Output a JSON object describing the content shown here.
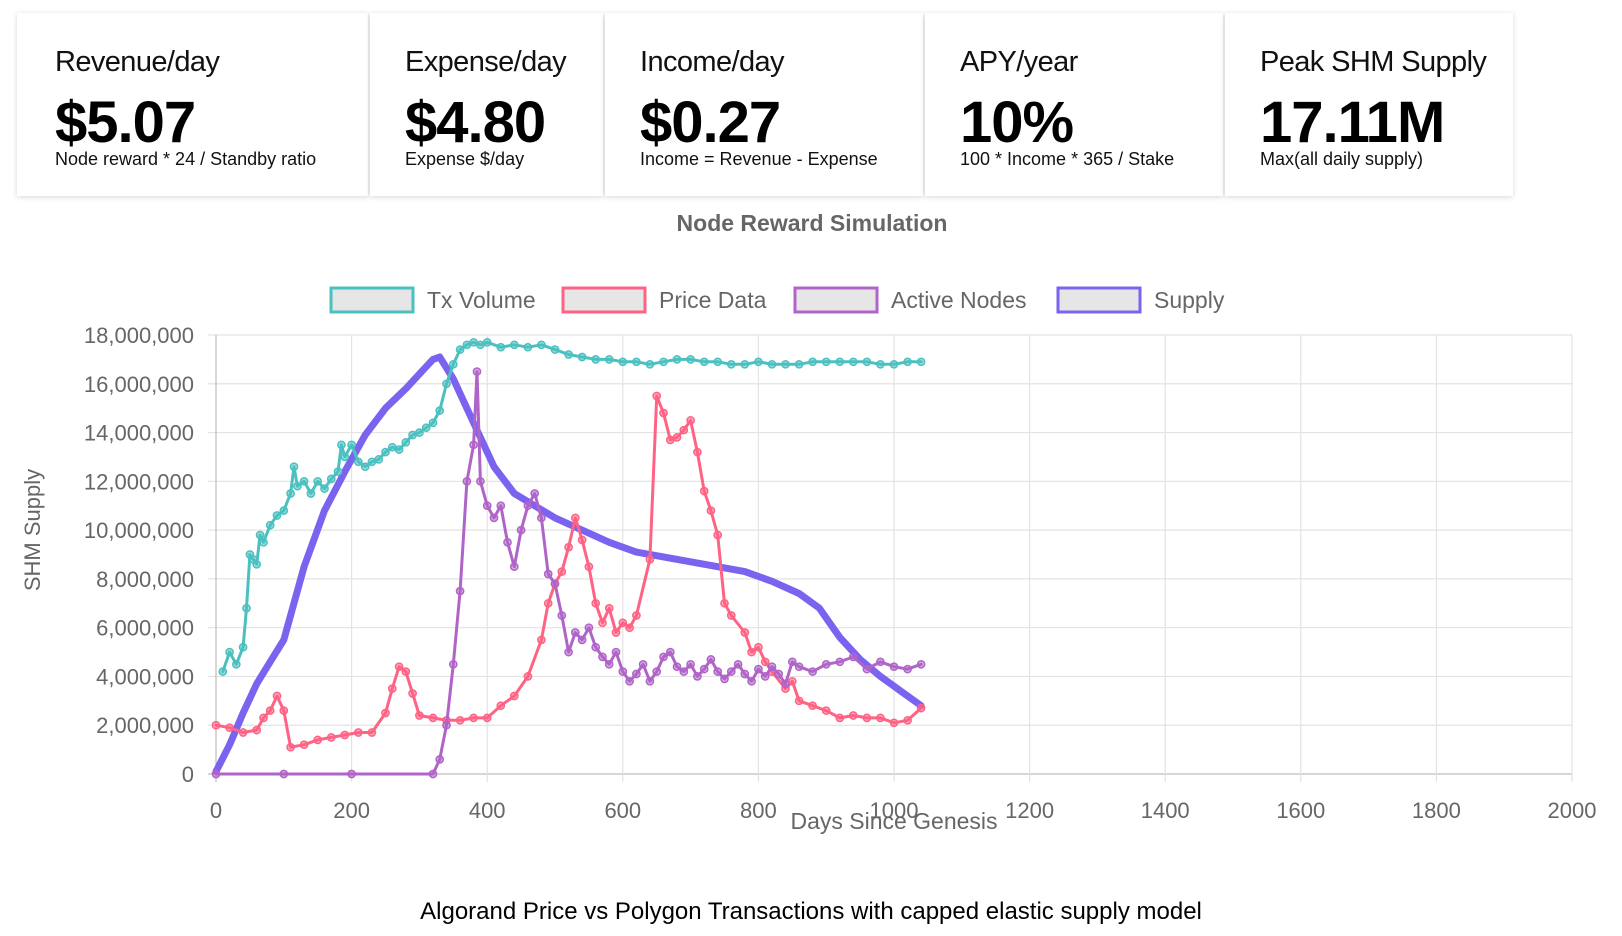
{
  "stats": [
    {
      "title": "Revenue/day",
      "value": "$5.07",
      "sub": "Node reward * 24 / Standby ratio"
    },
    {
      "title": "Expense/day",
      "value": "$4.80",
      "sub": "Expense $/day"
    },
    {
      "title": "Income/day",
      "value": "$0.27",
      "sub": "Income = Revenue - Expense"
    },
    {
      "title": "APY/year",
      "value": "10%",
      "sub": "100 * Income * 365 / Stake"
    },
    {
      "title": "Peak SHM Supply",
      "value": "17.11M",
      "sub": "Max(all daily supply)"
    }
  ],
  "caption": "Algorand Price vs Polygon Transactions with capped elastic supply model",
  "chart_data": {
    "type": "line",
    "title": "Node Reward Simulation",
    "xlabel": "Days Since Genesis",
    "ylabel": "SHM Supply",
    "xlim": [
      0,
      2000
    ],
    "ylim": [
      0,
      18000000
    ],
    "x_ticks": [
      "0",
      "200",
      "400",
      "600",
      "800",
      "1000",
      "1200",
      "1400",
      "1600",
      "1800",
      "2000"
    ],
    "y_ticks": [
      "0",
      "2,000,000",
      "4,000,000",
      "6,000,000",
      "8,000,000",
      "10,000,000",
      "12,000,000",
      "14,000,000",
      "16,000,000",
      "18,000,000"
    ],
    "grid": true,
    "legend_position": "top",
    "series": [
      {
        "name": "Tx Volume",
        "color": "#4bc0c0",
        "markers": true,
        "points": [
          [
            10,
            4200000
          ],
          [
            20,
            5000000
          ],
          [
            30,
            4500000
          ],
          [
            40,
            5200000
          ],
          [
            45,
            6800000
          ],
          [
            50,
            9000000
          ],
          [
            55,
            8800000
          ],
          [
            60,
            8600000
          ],
          [
            65,
            9800000
          ],
          [
            70,
            9500000
          ],
          [
            80,
            10200000
          ],
          [
            90,
            10600000
          ],
          [
            100,
            10800000
          ],
          [
            110,
            11500000
          ],
          [
            115,
            12600000
          ],
          [
            120,
            11800000
          ],
          [
            130,
            12000000
          ],
          [
            140,
            11500000
          ],
          [
            150,
            12000000
          ],
          [
            160,
            11700000
          ],
          [
            170,
            12100000
          ],
          [
            180,
            12400000
          ],
          [
            185,
            13500000
          ],
          [
            190,
            13000000
          ],
          [
            200,
            13500000
          ],
          [
            210,
            12800000
          ],
          [
            220,
            12600000
          ],
          [
            230,
            12800000
          ],
          [
            240,
            12900000
          ],
          [
            250,
            13200000
          ],
          [
            260,
            13400000
          ],
          [
            270,
            13300000
          ],
          [
            280,
            13600000
          ],
          [
            290,
            13900000
          ],
          [
            300,
            14000000
          ],
          [
            310,
            14200000
          ],
          [
            320,
            14400000
          ],
          [
            330,
            14900000
          ],
          [
            340,
            16000000
          ],
          [
            350,
            16800000
          ],
          [
            360,
            17400000
          ],
          [
            370,
            17600000
          ],
          [
            380,
            17700000
          ],
          [
            390,
            17600000
          ],
          [
            400,
            17700000
          ],
          [
            420,
            17500000
          ],
          [
            440,
            17600000
          ],
          [
            460,
            17500000
          ],
          [
            480,
            17600000
          ],
          [
            500,
            17400000
          ],
          [
            520,
            17200000
          ],
          [
            540,
            17100000
          ],
          [
            560,
            17000000
          ],
          [
            580,
            17000000
          ],
          [
            600,
            16900000
          ],
          [
            620,
            16900000
          ],
          [
            640,
            16800000
          ],
          [
            660,
            16900000
          ],
          [
            680,
            17000000
          ],
          [
            700,
            17000000
          ],
          [
            720,
            16900000
          ],
          [
            740,
            16900000
          ],
          [
            760,
            16800000
          ],
          [
            780,
            16800000
          ],
          [
            800,
            16900000
          ],
          [
            820,
            16800000
          ],
          [
            840,
            16800000
          ],
          [
            860,
            16800000
          ],
          [
            880,
            16900000
          ],
          [
            900,
            16900000
          ],
          [
            920,
            16900000
          ],
          [
            940,
            16900000
          ],
          [
            960,
            16900000
          ],
          [
            980,
            16800000
          ],
          [
            1000,
            16800000
          ],
          [
            1020,
            16900000
          ],
          [
            1040,
            16900000
          ]
        ]
      },
      {
        "name": "Price Data",
        "color": "#ff6384",
        "markers": true,
        "points": [
          [
            0,
            2000000
          ],
          [
            20,
            1900000
          ],
          [
            40,
            1700000
          ],
          [
            60,
            1800000
          ],
          [
            70,
            2300000
          ],
          [
            80,
            2600000
          ],
          [
            90,
            3200000
          ],
          [
            100,
            2600000
          ],
          [
            110,
            1100000
          ],
          [
            130,
            1200000
          ],
          [
            150,
            1400000
          ],
          [
            170,
            1500000
          ],
          [
            190,
            1600000
          ],
          [
            210,
            1700000
          ],
          [
            230,
            1700000
          ],
          [
            250,
            2500000
          ],
          [
            260,
            3500000
          ],
          [
            270,
            4400000
          ],
          [
            280,
            4200000
          ],
          [
            290,
            3300000
          ],
          [
            300,
            2400000
          ],
          [
            320,
            2300000
          ],
          [
            340,
            2200000
          ],
          [
            360,
            2200000
          ],
          [
            380,
            2300000
          ],
          [
            400,
            2300000
          ],
          [
            420,
            2800000
          ],
          [
            440,
            3200000
          ],
          [
            460,
            4000000
          ],
          [
            480,
            5500000
          ],
          [
            490,
            7000000
          ],
          [
            500,
            7800000
          ],
          [
            510,
            8300000
          ],
          [
            520,
            9300000
          ],
          [
            530,
            10500000
          ],
          [
            540,
            9600000
          ],
          [
            550,
            8500000
          ],
          [
            560,
            7000000
          ],
          [
            570,
            6200000
          ],
          [
            580,
            6800000
          ],
          [
            590,
            5800000
          ],
          [
            600,
            6200000
          ],
          [
            610,
            6000000
          ],
          [
            620,
            6500000
          ],
          [
            640,
            8800000
          ],
          [
            650,
            15500000
          ],
          [
            660,
            14800000
          ],
          [
            670,
            13700000
          ],
          [
            680,
            13800000
          ],
          [
            690,
            14100000
          ],
          [
            700,
            14500000
          ],
          [
            710,
            13200000
          ],
          [
            720,
            11600000
          ],
          [
            730,
            10800000
          ],
          [
            740,
            9800000
          ],
          [
            750,
            7000000
          ],
          [
            760,
            6500000
          ],
          [
            780,
            5800000
          ],
          [
            790,
            5000000
          ],
          [
            800,
            5200000
          ],
          [
            810,
            4600000
          ],
          [
            820,
            4200000
          ],
          [
            840,
            3500000
          ],
          [
            850,
            3800000
          ],
          [
            860,
            3000000
          ],
          [
            880,
            2800000
          ],
          [
            900,
            2600000
          ],
          [
            920,
            2300000
          ],
          [
            940,
            2400000
          ],
          [
            960,
            2300000
          ],
          [
            980,
            2300000
          ],
          [
            1000,
            2100000
          ],
          [
            1020,
            2200000
          ],
          [
            1040,
            2700000
          ]
        ]
      },
      {
        "name": "Active Nodes",
        "color": "#b064c8",
        "markers": true,
        "points": [
          [
            0,
            0
          ],
          [
            100,
            0
          ],
          [
            200,
            0
          ],
          [
            320,
            0
          ],
          [
            330,
            600000
          ],
          [
            340,
            2000000
          ],
          [
            350,
            4500000
          ],
          [
            360,
            7500000
          ],
          [
            370,
            12000000
          ],
          [
            380,
            13500000
          ],
          [
            385,
            16500000
          ],
          [
            390,
            12000000
          ],
          [
            400,
            11000000
          ],
          [
            410,
            10500000
          ],
          [
            420,
            11000000
          ],
          [
            430,
            9500000
          ],
          [
            440,
            8500000
          ],
          [
            450,
            10000000
          ],
          [
            460,
            11000000
          ],
          [
            470,
            11500000
          ],
          [
            480,
            10500000
          ],
          [
            490,
            8200000
          ],
          [
            500,
            7800000
          ],
          [
            510,
            6500000
          ],
          [
            520,
            5000000
          ],
          [
            530,
            5800000
          ],
          [
            540,
            5500000
          ],
          [
            550,
            6000000
          ],
          [
            560,
            5200000
          ],
          [
            570,
            4800000
          ],
          [
            580,
            4500000
          ],
          [
            590,
            5000000
          ],
          [
            600,
            4200000
          ],
          [
            610,
            3800000
          ],
          [
            620,
            4100000
          ],
          [
            630,
            4500000
          ],
          [
            640,
            3800000
          ],
          [
            650,
            4200000
          ],
          [
            660,
            4800000
          ],
          [
            670,
            5000000
          ],
          [
            680,
            4400000
          ],
          [
            690,
            4200000
          ],
          [
            700,
            4500000
          ],
          [
            710,
            4000000
          ],
          [
            720,
            4300000
          ],
          [
            730,
            4700000
          ],
          [
            740,
            4200000
          ],
          [
            750,
            3900000
          ],
          [
            760,
            4200000
          ],
          [
            770,
            4500000
          ],
          [
            780,
            4100000
          ],
          [
            790,
            3800000
          ],
          [
            800,
            4300000
          ],
          [
            810,
            4000000
          ],
          [
            820,
            4400000
          ],
          [
            830,
            4100000
          ],
          [
            840,
            3700000
          ],
          [
            850,
            4600000
          ],
          [
            860,
            4400000
          ],
          [
            880,
            4200000
          ],
          [
            900,
            4500000
          ],
          [
            920,
            4600000
          ],
          [
            940,
            4800000
          ],
          [
            960,
            4300000
          ],
          [
            980,
            4600000
          ],
          [
            1000,
            4400000
          ],
          [
            1020,
            4300000
          ],
          [
            1040,
            4500000
          ]
        ]
      },
      {
        "name": "Supply",
        "color": "#7b63f0",
        "markers": false,
        "points": [
          [
            0,
            100000
          ],
          [
            20,
            1200000
          ],
          [
            40,
            2500000
          ],
          [
            60,
            3700000
          ],
          [
            80,
            4600000
          ],
          [
            100,
            5500000
          ],
          [
            130,
            8500000
          ],
          [
            160,
            10800000
          ],
          [
            190,
            12400000
          ],
          [
            220,
            13900000
          ],
          [
            250,
            15000000
          ],
          [
            280,
            15800000
          ],
          [
            300,
            16400000
          ],
          [
            320,
            17000000
          ],
          [
            330,
            17100000
          ],
          [
            350,
            16200000
          ],
          [
            380,
            14400000
          ],
          [
            410,
            12600000
          ],
          [
            440,
            11500000
          ],
          [
            470,
            11000000
          ],
          [
            500,
            10500000
          ],
          [
            540,
            10000000
          ],
          [
            580,
            9500000
          ],
          [
            620,
            9100000
          ],
          [
            660,
            8900000
          ],
          [
            700,
            8700000
          ],
          [
            740,
            8500000
          ],
          [
            780,
            8300000
          ],
          [
            820,
            7900000
          ],
          [
            860,
            7400000
          ],
          [
            890,
            6800000
          ],
          [
            920,
            5600000
          ],
          [
            950,
            4700000
          ],
          [
            980,
            4000000
          ],
          [
            1010,
            3400000
          ],
          [
            1040,
            2800000
          ]
        ]
      }
    ]
  }
}
